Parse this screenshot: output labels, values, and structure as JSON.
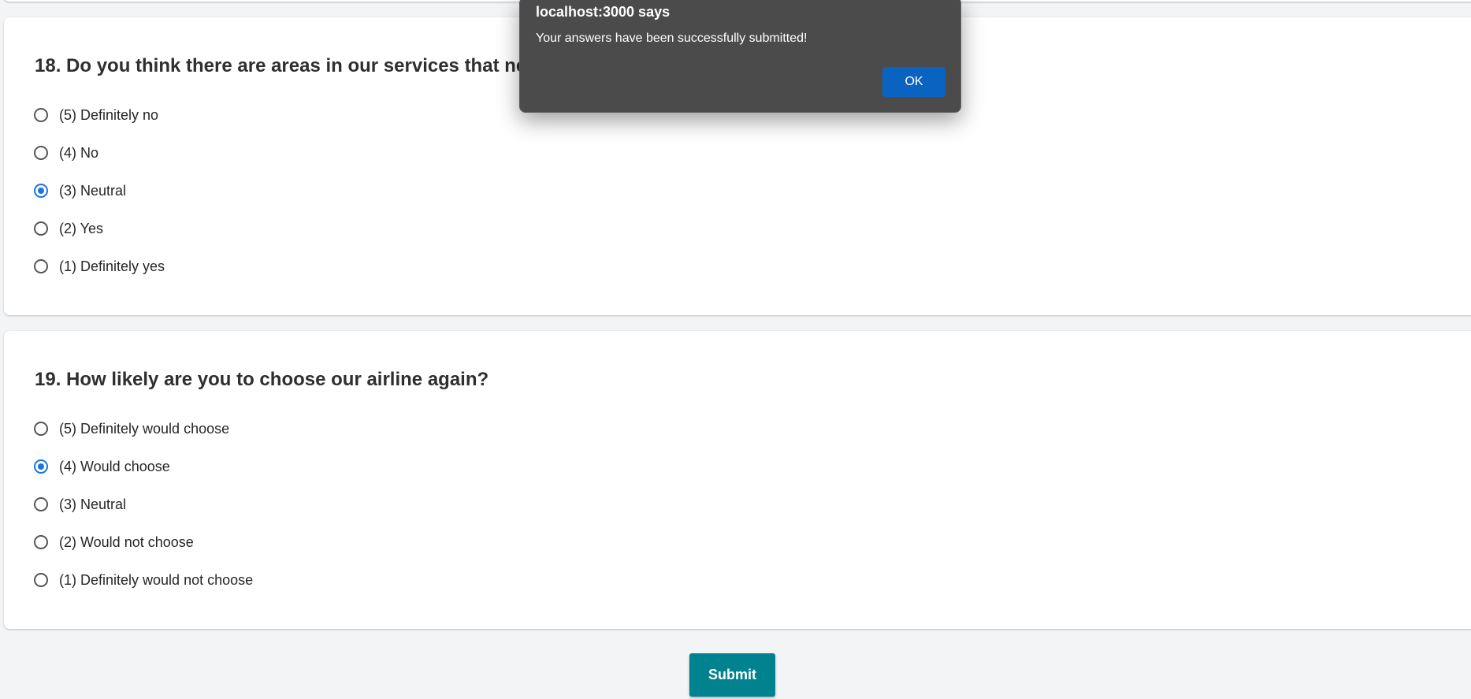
{
  "survey": {
    "questions": [
      {
        "title": "18. Do you think there are areas in our services that ne",
        "options": [
          {
            "label": "(5) Definitely no",
            "checked": false
          },
          {
            "label": "(4) No",
            "checked": false
          },
          {
            "label": "(3) Neutral",
            "checked": true
          },
          {
            "label": "(2) Yes",
            "checked": false
          },
          {
            "label": "(1) Definitely yes",
            "checked": false
          }
        ]
      },
      {
        "title": "19. How likely are you to choose our airline again?",
        "options": [
          {
            "label": "(5) Definitely would choose",
            "checked": false
          },
          {
            "label": "(4) Would choose",
            "checked": true
          },
          {
            "label": "(3) Neutral",
            "checked": false
          },
          {
            "label": "(2) Would not choose",
            "checked": false
          },
          {
            "label": "(1) Definitely would not choose",
            "checked": false
          }
        ]
      }
    ],
    "submit_label": "Submit"
  },
  "alert": {
    "title": "localhost:3000 says",
    "message": "Your answers have been successfully submitted!",
    "ok_label": "OK"
  },
  "colors": {
    "page_background": "#f3f4f6",
    "selected_radio": "#1a73e8",
    "submit_button": "#00838f",
    "alert_background": "#4b4b4b",
    "ok_button": "#0b63c1"
  }
}
